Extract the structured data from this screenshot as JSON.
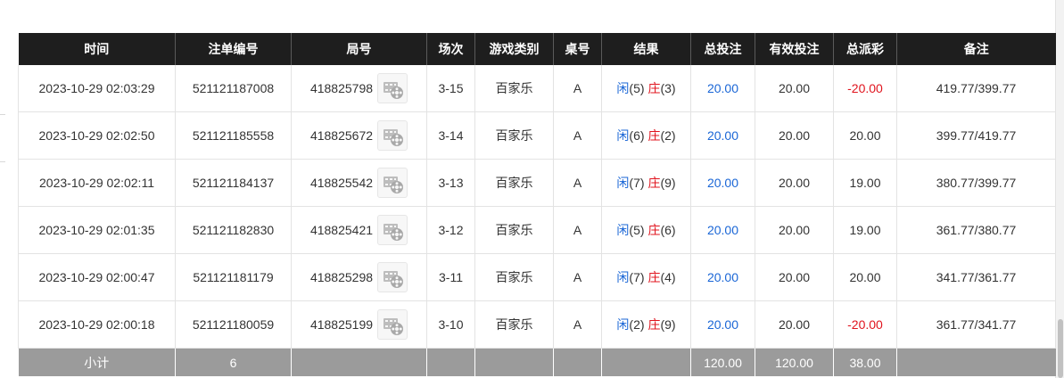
{
  "table": {
    "headers": [
      "时间",
      "注单编号",
      "局号",
      "场次",
      "游戏类别",
      "桌号",
      "结果",
      "总投注",
      "有效投注",
      "总派彩",
      "备注"
    ],
    "rows": [
      {
        "time": "2023-10-29 02:03:29",
        "bet_id": "521121187008",
        "round": "418825798",
        "session": "3-15",
        "game": "百家乐",
        "table": "A",
        "player_label": "闲",
        "player_score": "(5)",
        "banker_label": "庄",
        "banker_score": "(3)",
        "total_bet": "20.00",
        "valid_bet": "20.00",
        "payout": "-20.00",
        "remark": "419.77/399.77"
      },
      {
        "time": "2023-10-29 02:02:50",
        "bet_id": "521121185558",
        "round": "418825672",
        "session": "3-14",
        "game": "百家乐",
        "table": "A",
        "player_label": "闲",
        "player_score": "(6)",
        "banker_label": "庄",
        "banker_score": "(2)",
        "total_bet": "20.00",
        "valid_bet": "20.00",
        "payout": "20.00",
        "remark": "399.77/419.77"
      },
      {
        "time": "2023-10-29 02:02:11",
        "bet_id": "521121184137",
        "round": "418825542",
        "session": "3-13",
        "game": "百家乐",
        "table": "A",
        "player_label": "闲",
        "player_score": "(7)",
        "banker_label": "庄",
        "banker_score": "(9)",
        "total_bet": "20.00",
        "valid_bet": "20.00",
        "payout": "19.00",
        "remark": "380.77/399.77"
      },
      {
        "time": "2023-10-29 02:01:35",
        "bet_id": "521121182830",
        "round": "418825421",
        "session": "3-12",
        "game": "百家乐",
        "table": "A",
        "player_label": "闲",
        "player_score": "(5)",
        "banker_label": "庄",
        "banker_score": "(6)",
        "total_bet": "20.00",
        "valid_bet": "20.00",
        "payout": "19.00",
        "remark": "361.77/380.77"
      },
      {
        "time": "2023-10-29 02:00:47",
        "bet_id": "521121181179",
        "round": "418825298",
        "session": "3-11",
        "game": "百家乐",
        "table": "A",
        "player_label": "闲",
        "player_score": "(7)",
        "banker_label": "庄",
        "banker_score": "(4)",
        "total_bet": "20.00",
        "valid_bet": "20.00",
        "payout": "20.00",
        "remark": "341.77/361.77"
      },
      {
        "time": "2023-10-29 02:00:18",
        "bet_id": "521121180059",
        "round": "418825199",
        "session": "3-10",
        "game": "百家乐",
        "table": "A",
        "player_label": "闲",
        "player_score": "(2)",
        "banker_label": "庄",
        "banker_score": "(9)",
        "total_bet": "20.00",
        "valid_bet": "20.00",
        "payout": "-20.00",
        "remark": "361.77/341.77"
      }
    ],
    "subtotal": {
      "label": "小计",
      "count": "6",
      "total_bet": "120.00",
      "valid_bet": "120.00",
      "payout": "38.00"
    }
  },
  "icons": {
    "replay": "film-reel-icon"
  },
  "colors": {
    "header_bg": "#1e1e1e",
    "footer_bg": "#9b9b9b",
    "blue": "#1a66d6",
    "red": "#e0141e"
  }
}
